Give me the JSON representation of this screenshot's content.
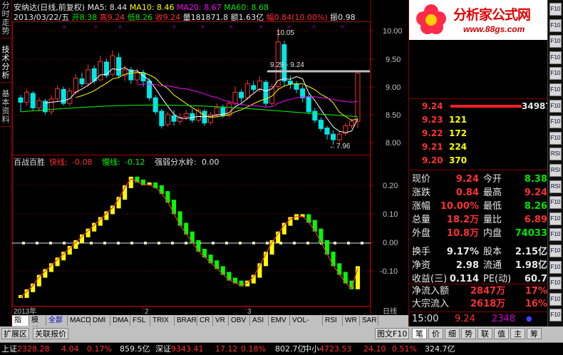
{
  "left_tabs": [
    "分时走势",
    "技术分析",
    "基本资料"
  ],
  "header": {
    "stock_name": "安纳达(日线,前复权)",
    "ma5": "MA5: 8.44",
    "ma10": "MA10: 8.46",
    "ma20": "MA20: 8.67",
    "ma60": "MA60: 8.68",
    "info_line": {
      "date": "2013/03/22/五",
      "open_label": "开",
      "open": "8.38",
      "high_label": "高",
      "high": "9.24",
      "low_label": "低",
      "low": "8.26",
      "close_label": "收",
      "close": "9.24",
      "volume_label": "量",
      "volume": "181871.8",
      "amount_label": "额",
      "amount": "1.63亿",
      "change_label": "幅",
      "change": "0.84(10.00%)",
      "amplitude_label": "振",
      "amplitude": "0.98"
    }
  },
  "price_axis": [
    "10.00",
    "9.50",
    "9.00",
    "8.50",
    "8.00"
  ],
  "annotations": {
    "high_label": "10.05",
    "range_label": "9.29 - 9.24",
    "low_label": "7.96"
  },
  "indicator": {
    "name": "百战百胜",
    "fast_label": "快线:",
    "fast_value": "-0.08",
    "slow_label": "慢线:",
    "slow_value": "-0.12",
    "water_label": "强弱分水岭:",
    "water_value": "0.00",
    "axis": [
      "0.20",
      "0.10",
      "0.00",
      "-0.10"
    ]
  },
  "time_axis": {
    "year_label": "2013年",
    "month2": "2",
    "month3": "3",
    "period": "日线"
  },
  "bottom_tabs": [
    "指标",
    "模板",
    "全部",
    "MACD",
    "DMI",
    "DMA",
    "FSL",
    "TRIX",
    "BRAR",
    "CR",
    "VR",
    "OBV",
    "ASI",
    "EMV",
    "VOL-TDX",
    "RSI",
    "WR",
    "SAR"
  ],
  "second_bar_tabs": [
    "扩展区",
    "关联报价"
  ],
  "right_panel": {
    "logo_text": "分析家公式网",
    "logo_url": "www.88gs.com",
    "sell_price": "9.24",
    "sell_volume": "34987",
    "buy_rows": [
      {
        "price": "9.23",
        "volume": "121"
      },
      {
        "price": "9.22",
        "volume": "172"
      },
      {
        "price": "9.21",
        "volume": "224"
      },
      {
        "price": "9.20",
        "volume": "370"
      }
    ],
    "quote": [
      {
        "l1": "现价",
        "v1": "9.24",
        "l2": "今开",
        "v2": "8.38"
      },
      {
        "l1": "涨跌",
        "v1": "0.84",
        "l2": "最高",
        "v2": "9.24"
      },
      {
        "l1": "涨幅",
        "v1": "10.00%",
        "l2": "最低",
        "v2": "8.26"
      },
      {
        "l1": "总量",
        "v1": "18.2万",
        "l2": "量比",
        "v2": "6.89"
      },
      {
        "l1": "外盘",
        "v1": "10.8万",
        "l2": "内盘",
        "v2": "74033"
      },
      {
        "l1": "换手",
        "v1": "9.17%",
        "l2": "股本",
        "v2": "2.15亿"
      },
      {
        "l1": "净资",
        "v1": "2.98",
        "l2": "流通",
        "v2": "1.98亿"
      },
      {
        "l1": "收益(三)",
        "v1": "0.114",
        "l2": "PE(动)",
        "v2": "60.7"
      }
    ],
    "flow": [
      {
        "label": "净流入额",
        "value": "2847万",
        "pct": "17%"
      },
      {
        "label": "大宗流入",
        "value": "2618万",
        "pct": "16%"
      }
    ],
    "tick": {
      "time": "15:00",
      "price": "9.24",
      "volume": "2348",
      "mark": "●"
    },
    "tab_left": "图文F10",
    "tabs": [
      "笔",
      "价",
      "细",
      "势",
      "联",
      "值",
      "主",
      "筹"
    ]
  },
  "tool_strip": [
    "F10",
    "F10",
    "F10",
    "F10",
    "F10",
    "F10",
    "F10",
    "F10",
    "F10",
    "RSI",
    "RSI",
    "RSI",
    "F10",
    "F10",
    "F10",
    "F10",
    "F10",
    "F10",
    "F10",
    "F10"
  ],
  "status": {
    "sh_label": "上证",
    "sh_index": "2328.28",
    "sh_change": "4.04",
    "sh_pct": "0.17%",
    "sh_amount": "859.5亿",
    "sz_label": "深证",
    "sz_index": "9343.41",
    "sz_change": "17.12",
    "sz_pct": "0.18%",
    "sz_amount": "802.7亿",
    "zx_label": "中小",
    "zx_index": "4723.53",
    "zx_change": "24.10",
    "zx_pct": "0.51%",
    "zx_amount": "324.7亿"
  },
  "colors": {
    "up": "#ff3232",
    "down": "#00e6e6",
    "ma5": "#ffffff",
    "ma10": "#ffff00",
    "ma20": "#ff00ff",
    "ma60": "#00ff00",
    "fast": "#ffff00",
    "slow_down": "#00ff00"
  }
}
